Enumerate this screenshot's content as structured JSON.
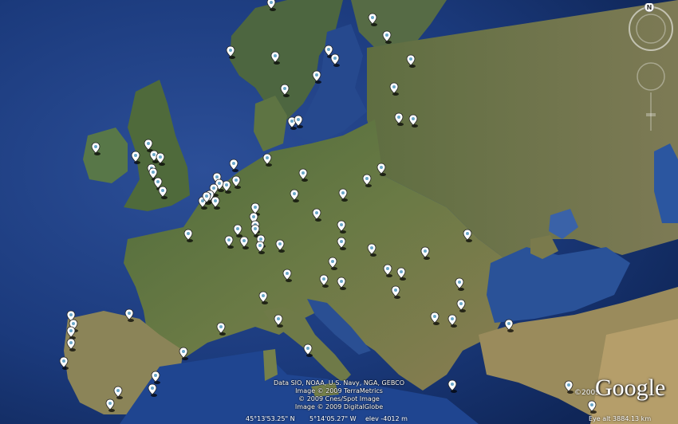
{
  "map": {
    "markers": [
      {
        "id": 1
      },
      {
        "id": 2
      },
      {
        "id": 3
      },
      {
        "id": 4
      },
      {
        "id": 5
      },
      {
        "id": 6
      },
      {
        "id": 7
      },
      {
        "id": 8
      },
      {
        "id": 9
      },
      {
        "id": 10
      },
      {
        "id": 11
      },
      {
        "id": 12
      },
      {
        "id": 13
      },
      {
        "id": 14
      },
      {
        "id": 15
      },
      {
        "id": 16
      },
      {
        "id": 17
      },
      {
        "id": 18
      },
      {
        "id": 19
      },
      {
        "id": 20
      }
    ]
  },
  "credits": {
    "line1": "Data SIO, NOAA, U.S. Navy, NGA, GEBCO",
    "line2": "Image © 2009 TerraMetrics",
    "line3": "© 2009 Cnes/Spot Image",
    "line4": "Image © 2009 DigitalGlobe"
  },
  "status": {
    "latitude": "45°13'53.25\" N",
    "longitude": "5°14'05.27\" W",
    "elevation": "elev -4012 m",
    "eye_alt": "Eye alt 3884.13 km"
  },
  "logo": {
    "year": "©2009",
    "text": "Google"
  },
  "navigation": {
    "north_label": "N"
  }
}
